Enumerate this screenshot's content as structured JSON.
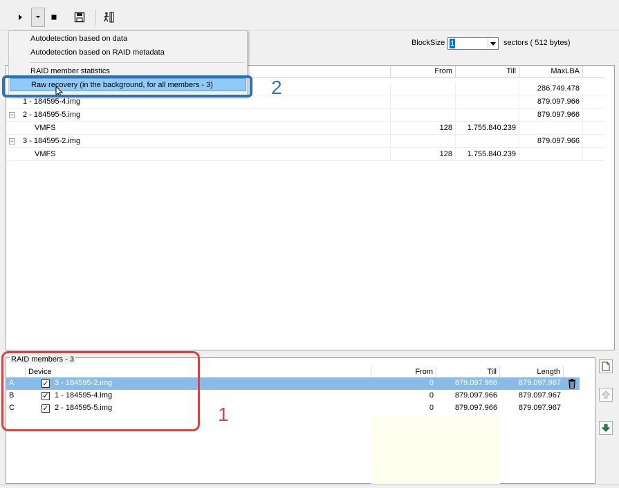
{
  "toolbar": {
    "buttons": [
      {
        "name": "play",
        "icon": "play-icon"
      },
      {
        "name": "play-dropdown",
        "icon": "chevron-down-icon"
      },
      {
        "name": "stop",
        "icon": "stop-icon"
      },
      {
        "name": "save",
        "icon": "save-icon"
      },
      {
        "name": "exit",
        "icon": "exit-icon"
      }
    ]
  },
  "menu": {
    "items": [
      {
        "label": "Autodetection based on data"
      },
      {
        "label": "Autodetection based on RAID metadata"
      },
      {
        "label": "RAID member statistics"
      },
      {
        "label": "Raw recovery (in the background, for all members - 3)",
        "highlighted": true
      }
    ]
  },
  "blocksize": {
    "label": "BlockSize",
    "value": "1",
    "units": "sectors ( 512 bytes)"
  },
  "tree": {
    "headers": {
      "from": "From",
      "till": "Till",
      "maxlba": "MaxLBA"
    },
    "rows": [
      {
        "name": "",
        "from": "",
        "till": "",
        "maxlba": "286.749.478"
      },
      {
        "name": "1 - 184595-4.img",
        "from": "",
        "till": "",
        "maxlba": "879.097.966"
      },
      {
        "name": "2 - 184595-5.img",
        "from": "",
        "till": "",
        "maxlba": "879.097.966",
        "toggle": "−"
      },
      {
        "name": "VMFS",
        "from": "128",
        "till": "1.755.840.239",
        "maxlba": ""
      },
      {
        "name": "3 - 184595-2.img",
        "from": "",
        "till": "",
        "maxlba": "879.097.966",
        "toggle": "−"
      },
      {
        "name": "VMFS",
        "from": "128",
        "till": "1.755.840.239",
        "maxlba": ""
      }
    ]
  },
  "members": {
    "title": "RAID members - 3",
    "headers": {
      "device": "Device",
      "from": "From",
      "till": "Till",
      "length": "Length"
    },
    "rows": [
      {
        "letter": "A",
        "device": "3 - 184595-2.img",
        "from": "0",
        "till": "879.097.966",
        "length": "879.097.967",
        "selected": true
      },
      {
        "letter": "B",
        "device": "1 - 184595-4.img",
        "from": "0",
        "till": "879.097.966",
        "length": "879.097.967"
      },
      {
        "letter": "C",
        "device": "2 - 184595-5.img",
        "from": "0",
        "till": "879.097.966",
        "length": "879.097.967"
      }
    ]
  },
  "annotations": {
    "red": "1",
    "blue": "2"
  },
  "colors": {
    "highlight": "#91c9f7",
    "selected_row": "#89bbe8",
    "red_annotation": "#e0403a",
    "blue_annotation": "#2e74b5"
  }
}
